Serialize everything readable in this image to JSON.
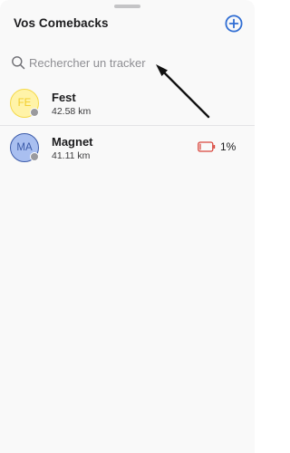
{
  "header": {
    "title": "Vos Comebacks",
    "add_icon": "plus-circle-icon"
  },
  "search": {
    "placeholder": "Rechercher un tracker",
    "value": "",
    "icon": "search-icon"
  },
  "trackers": [
    {
      "initials": "FE",
      "name": "Fest",
      "distance": "42.58 km",
      "status": "offline"
    },
    {
      "initials": "MA",
      "name": "Magnet",
      "distance": "41.11 km",
      "status": "offline",
      "battery": "1%"
    }
  ],
  "colors": {
    "accent": "#2f6dd3",
    "fest_avatar_bg": "#fff3a8",
    "magnet_avatar_bg": "#a9bff0",
    "battery_low": "#d9453b",
    "status_dot": "#9a9a9e"
  }
}
